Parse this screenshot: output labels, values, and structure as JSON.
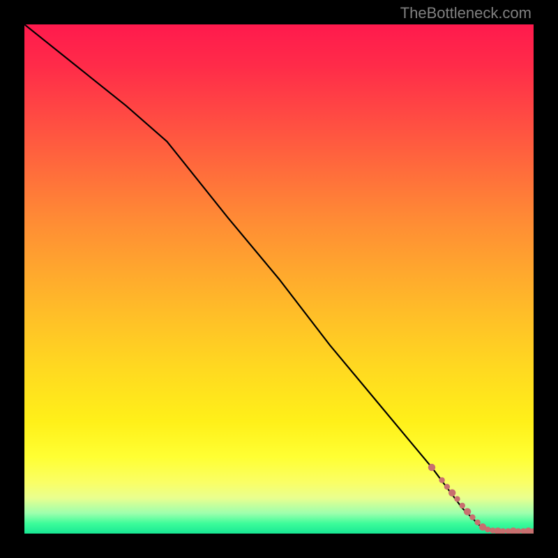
{
  "watermark": "TheBottleneck.com",
  "chart_data": {
    "type": "line",
    "title": "",
    "xlabel": "",
    "ylabel": "",
    "xlim": [
      0,
      100
    ],
    "ylim": [
      0,
      100
    ],
    "series": [
      {
        "name": "curve",
        "style": "line",
        "color": "#000000",
        "x": [
          0,
          10,
          20,
          28,
          40,
          50,
          60,
          70,
          80,
          86,
          90,
          95,
          100
        ],
        "values": [
          100,
          92,
          84,
          77,
          62,
          50,
          37,
          25,
          13,
          5,
          1,
          0.5,
          0.5
        ]
      },
      {
        "name": "markers",
        "style": "scatter",
        "color": "#c86f6f",
        "x": [
          80,
          82,
          83,
          84,
          85,
          86,
          87,
          88,
          89,
          90,
          91,
          92,
          93,
          94,
          95,
          96,
          97,
          98,
          99,
          100
        ],
        "values": [
          13,
          10.5,
          9.2,
          8.0,
          6.8,
          5.5,
          4.3,
          3.2,
          2.2,
          1.3,
          0.8,
          0.6,
          0.5,
          0.5,
          0.5,
          0.5,
          0.5,
          0.5,
          0.5,
          0.5
        ]
      }
    ]
  }
}
